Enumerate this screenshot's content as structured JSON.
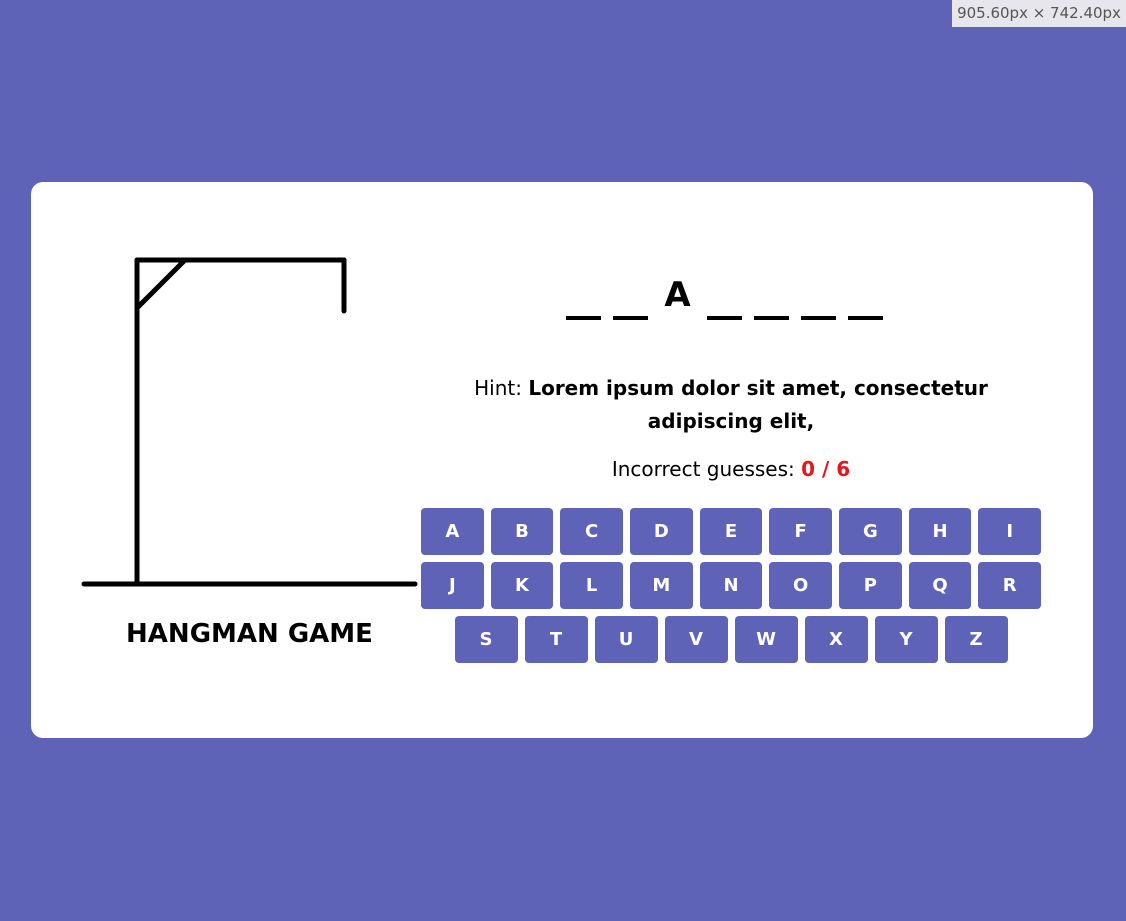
{
  "viewport_badge": "905.60px × 742.40px",
  "colors": {
    "background": "#5e63b8",
    "card": "#ffffff",
    "key": "#5e63b8",
    "incorrect_count": "#e8151b"
  },
  "game": {
    "title": "HANGMAN GAME",
    "word_slots": [
      "",
      "",
      "A",
      "",
      "",
      "",
      ""
    ],
    "hint_label": "Hint: ",
    "hint_text": "Lorem ipsum dolor sit amet, consectetur adipiscing elit,",
    "incorrect_label": "Incorrect guesses: ",
    "incorrect_count": "0 / 6"
  },
  "keyboard": {
    "rows": [
      [
        "A",
        "B",
        "C",
        "D",
        "E",
        "F",
        "G",
        "H",
        "I"
      ],
      [
        "J",
        "K",
        "L",
        "M",
        "N",
        "O",
        "P",
        "Q",
        "R"
      ],
      [
        "S",
        "T",
        "U",
        "V",
        "W",
        "X",
        "Y",
        "Z"
      ]
    ]
  }
}
